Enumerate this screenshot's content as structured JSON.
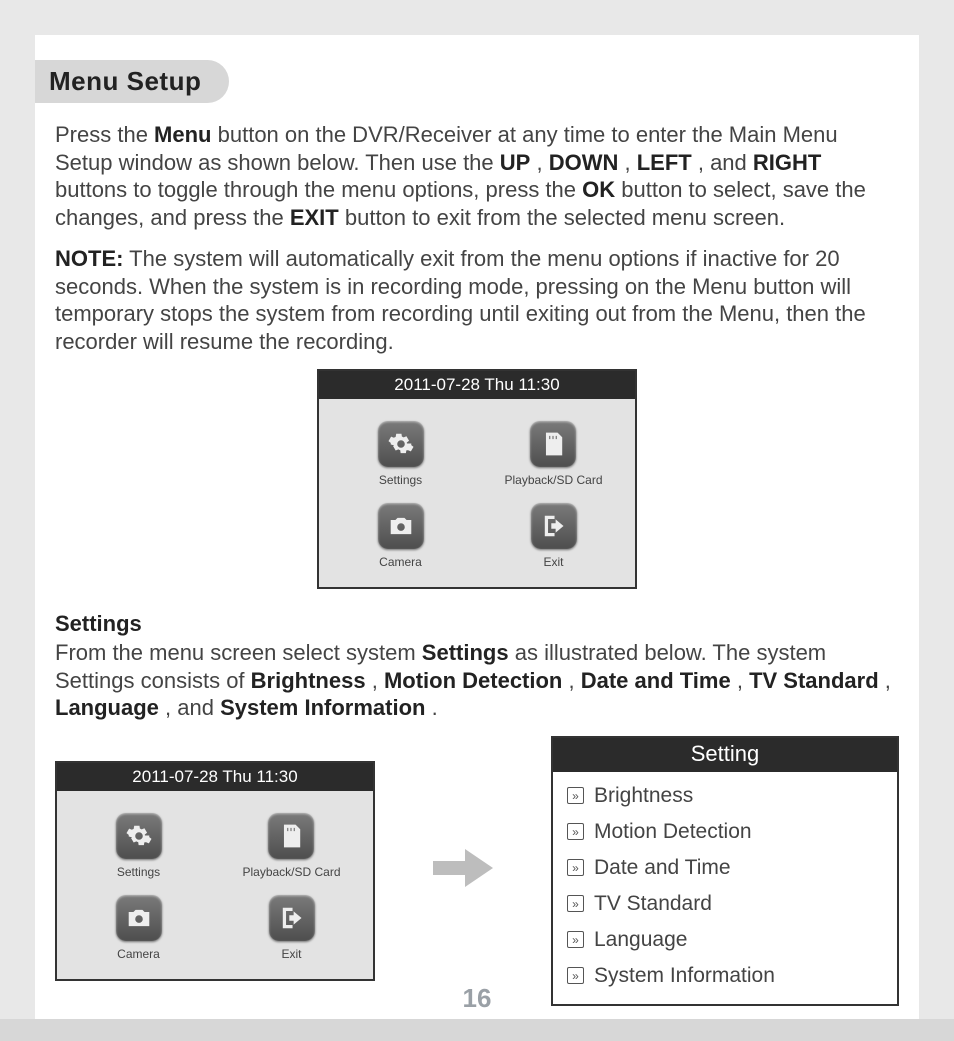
{
  "title": "Menu Setup",
  "para1": {
    "t1": "Press the ",
    "b1": "Menu",
    "t2": " button on the DVR/Receiver at any time to enter the Main Menu Setup window as shown below. Then use the ",
    "b2": "UP",
    "t3": ", ",
    "b3": "DOWN",
    "t4": ", ",
    "b4": "LEFT",
    "t5": ", and ",
    "b5": "RIGHT",
    "t6": " buttons to toggle through the menu options, press the ",
    "b6": "OK",
    "t7": " button to select, save the changes, and press the ",
    "b7": "EXIT",
    "t8": " button to exit from the selected menu screen."
  },
  "para2": {
    "b1": "NOTE:",
    "t1": " The system will automatically exit from the menu options if inactive for 20 seconds. When the system is in recording mode, pressing on the Menu button will temporary stops the system from recording until exiting out from the Menu, then the recorder will resume the recording."
  },
  "dvr": {
    "datetime": "2011-07-28 Thu  11:30",
    "items": {
      "settings": "Settings",
      "playback": "Playback/SD Card",
      "camera": "Camera",
      "exit": "Exit"
    }
  },
  "settingsSection": {
    "heading": "Settings",
    "text": {
      "t1": "From the menu screen select system ",
      "b1": "Settings",
      "t2": " as illustrated below. The system Settings consists of ",
      "b2": "Brightness",
      "t3": ", ",
      "b3": "Motion Detection",
      "t4": ", ",
      "b4": "Date and Time",
      "t5": ", ",
      "b5": "TV Standard",
      "t6": ", ",
      "b6": "Language",
      "t7": ", and ",
      "b7": "System Information",
      "t8": "."
    }
  },
  "settingsPanel": {
    "header": "Setting",
    "items": [
      "Brightness",
      "Motion Detection",
      "Date and Time",
      "TV Standard",
      "Language",
      "System Information"
    ]
  },
  "pageNumber": "16"
}
